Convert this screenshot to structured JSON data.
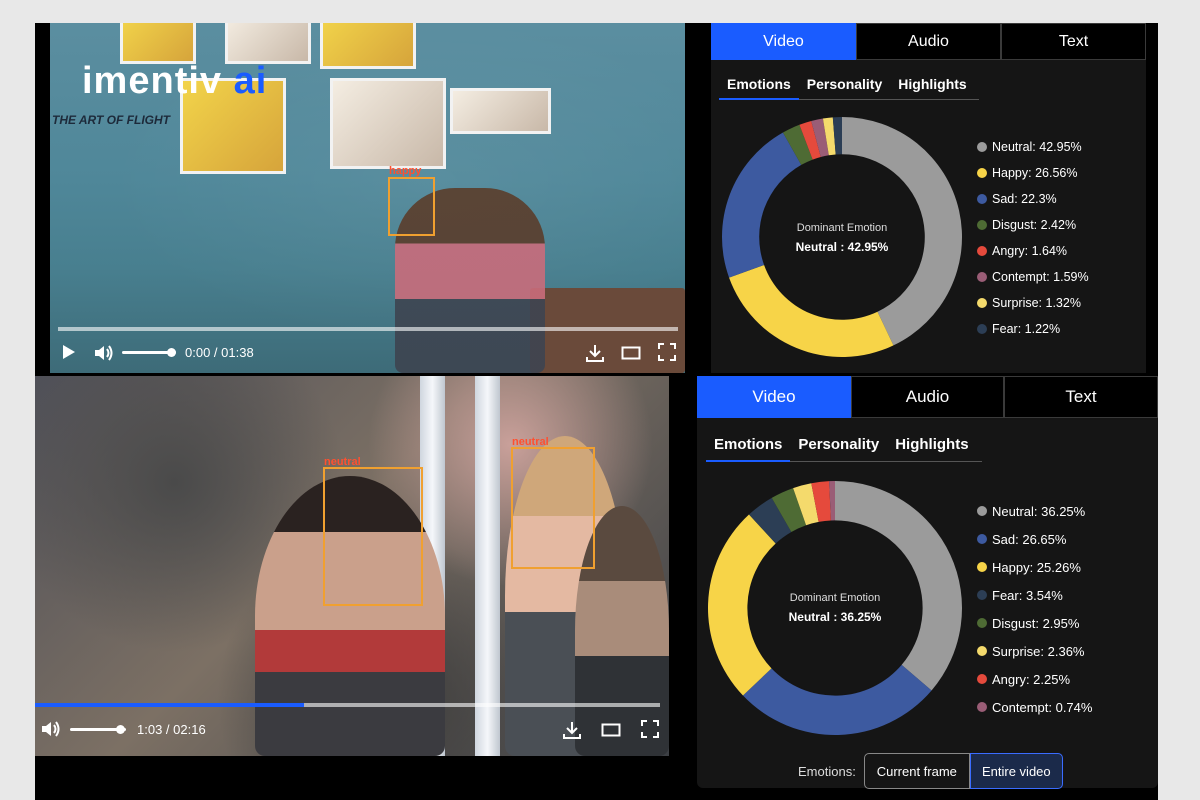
{
  "colors": {
    "accent": "#1a5cff",
    "neutral": "#9b9b9b",
    "happy": "#f7d448",
    "sad": "#3d5aa0",
    "disgust": "#4e6b34",
    "angry": "#e54a3c",
    "contempt": "#9a5d76",
    "surprise": "#f4da6c",
    "fear": "#2c3e55"
  },
  "brand": {
    "name": "imentiv",
    "suffix": "ai",
    "poster_text": "THE ART OF FLIGHT"
  },
  "video1": {
    "face_label": "happy",
    "time": "0:00 / 01:38",
    "progress": 0.0,
    "volume": 0.9,
    "icons": [
      "play-icon",
      "volume-icon",
      "download-icon",
      "theater-mode-icon",
      "fullscreen-icon"
    ]
  },
  "video2": {
    "face_labels": [
      "neutral",
      "neutral"
    ],
    "time": "1:03 / 02:16",
    "progress": 0.43,
    "volume": 0.9,
    "icons": [
      "volume-icon",
      "download-icon",
      "theater-mode-icon",
      "fullscreen-icon"
    ]
  },
  "panel1": {
    "tabs": [
      "Video",
      "Audio",
      "Text"
    ],
    "active_tab": "Video",
    "subtabs": [
      "Emotions",
      "Personality",
      "Highlights"
    ],
    "active_subtab": "Emotions",
    "center_title": "Dominant Emotion",
    "center_value": "Neutral : 42.95%",
    "legend": [
      "Neutral: 42.95%",
      "Happy: 26.56%",
      "Sad: 22.3%",
      "Disgust: 2.42%",
      "Angry: 1.64%",
      "Contempt: 1.59%",
      "Surprise: 1.32%",
      "Fear: 1.22%"
    ]
  },
  "panel2": {
    "tabs": [
      "Video",
      "Audio",
      "Text"
    ],
    "active_tab": "Video",
    "subtabs": [
      "Emotions",
      "Personality",
      "Highlights"
    ],
    "active_subtab": "Emotions",
    "center_title": "Dominant Emotion",
    "center_value": "Neutral : 36.25%",
    "legend": [
      "Neutral: 36.25%",
      "Sad: 26.65%",
      "Happy: 25.26%",
      "Fear: 3.54%",
      "Disgust: 2.95%",
      "Surprise: 2.36%",
      "Angry: 2.25%",
      "Contempt: 0.74%"
    ],
    "toggle_label": "Emotions:",
    "toggle_options": [
      "Current frame",
      "Entire video"
    ],
    "toggle_selected": "Entire video"
  },
  "chart_data": [
    {
      "type": "pie",
      "title": "Dominant Emotion",
      "categories": [
        "Neutral",
        "Happy",
        "Sad",
        "Disgust",
        "Angry",
        "Contempt",
        "Surprise",
        "Fear"
      ],
      "values": [
        42.95,
        26.56,
        22.3,
        2.42,
        1.64,
        1.59,
        1.32,
        1.22
      ],
      "colors": [
        "#9b9b9b",
        "#f7d448",
        "#3d5aa0",
        "#4e6b34",
        "#e54a3c",
        "#9a5d76",
        "#f4da6c",
        "#2c3e55"
      ],
      "legend": "right"
    },
    {
      "type": "pie",
      "title": "Dominant Emotion",
      "categories": [
        "Neutral",
        "Sad",
        "Happy",
        "Fear",
        "Disgust",
        "Surprise",
        "Angry",
        "Contempt"
      ],
      "values": [
        36.25,
        26.65,
        25.26,
        3.54,
        2.95,
        2.36,
        2.25,
        0.74
      ],
      "colors": [
        "#9b9b9b",
        "#3d5aa0",
        "#f7d448",
        "#2c3e55",
        "#4e6b34",
        "#f4da6c",
        "#e54a3c",
        "#9a5d76"
      ],
      "legend": "right"
    }
  ]
}
